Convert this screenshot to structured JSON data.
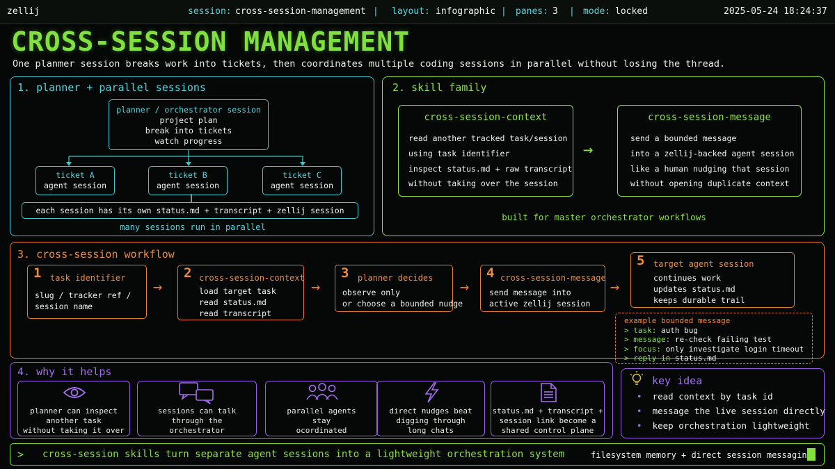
{
  "topbar": {
    "app": "zellij",
    "session_label": "session:",
    "session_value": "cross-session-management",
    "layout_label": "layout:",
    "layout_value": "infographic",
    "panes_label": "panes:",
    "panes_value": "3",
    "mode_label": "mode:",
    "mode_value": "locked",
    "separator": "|",
    "timestamp": "2025-05-24 18:24:37"
  },
  "header": {
    "title": "CROSS-SESSION MANAGEMENT",
    "subtitle": "One planmer session breaks work into tickets, then coordinates multiple coding sessions in parallel without losing the thread."
  },
  "panel1": {
    "title": "1. planner + parallel sessions",
    "planner": {
      "title": "planner / orchestrator session",
      "lines": [
        "project plan",
        "break into tickets",
        "watch progress"
      ]
    },
    "tickets": [
      {
        "title": "ticket A",
        "sub": "agent session"
      },
      {
        "title": "ticket B",
        "sub": "agent session"
      },
      {
        "title": "ticket C",
        "sub": "agent session"
      }
    ],
    "shared": "each session has its own status.md + transcript + zellij session",
    "footer": "many sessions run in parallel"
  },
  "panel2": {
    "title": "2. skill family",
    "context": {
      "title": "cross-session-context",
      "lines": [
        "read another tracked task/session",
        "using task identifier",
        "inspect status.md + raw transcript",
        "without taking over the session"
      ]
    },
    "arrow": "→",
    "message": {
      "title": "cross-session-message",
      "lines": [
        "send a bounded message",
        "into a zellij-backed agent session",
        "like a human nudging that session",
        "without opening duplicate context"
      ]
    },
    "footer": "built for master orchestrator workflows"
  },
  "panel3": {
    "title": "3. cross-session workflow",
    "arrow": "→",
    "steps": [
      {
        "num": "1",
        "title": "task identifier",
        "lines": [
          "slug / tracker ref /",
          "session name"
        ]
      },
      {
        "num": "2",
        "title": "cross-session-context",
        "lines": [
          "load target task",
          "read status.md",
          "read transcript"
        ]
      },
      {
        "num": "3",
        "title": "planner decides",
        "lines": [
          "observe only",
          "or choose a bounded nudge"
        ]
      },
      {
        "num": "4",
        "title": "cross-session-message",
        "lines": [
          "send message into",
          "active zellij session"
        ]
      },
      {
        "num": "5",
        "title": "target agent session",
        "lines": [
          "continues work",
          "updates status.md",
          "keeps durable trail"
        ]
      }
    ],
    "example": {
      "title": "example bounded message",
      "task_key": "> task:",
      "task_val": " auth bug",
      "msg_key": "> message:",
      "msg_val": " re-check failing test",
      "focus_key": "> focus:",
      "focus_val": " only investigate login timeout",
      "reply_key": "> reply in ",
      "reply_val": "status.md"
    }
  },
  "panel4": {
    "title": "4. why it helps",
    "items": [
      {
        "icon": "eye-icon",
        "lines": [
          "planner can inspect",
          "another task",
          "without taking it over"
        ]
      },
      {
        "icon": "chat-bubbles-icon",
        "lines": [
          "sessions can talk",
          "through the",
          "orchestrator"
        ]
      },
      {
        "icon": "people-group-icon",
        "lines": [
          "parallel agents",
          "stay",
          "ocordinated"
        ]
      },
      {
        "icon": "lightning-icon",
        "lines": [
          "direct nudges beat",
          "digging through",
          "long chats"
        ]
      },
      {
        "icon": "document-icon",
        "lines": [
          "status.md + transcript +",
          "session link become a",
          "shared control plane"
        ]
      }
    ]
  },
  "keyidea": {
    "title": "key idea",
    "icon": "lightbulb-icon",
    "bullet": "•",
    "items": [
      "read context by task id",
      "message the live session directly",
      "keep orchestration lightweight"
    ]
  },
  "bottombar": {
    "prompt": ">",
    "text": "cross-session skills turn separate agent sessions into a lightweight orchestration system",
    "right": "filesystem memory + direct session messaging"
  },
  "colors": {
    "cyan": "#4fd6df",
    "green": "#8ee04a",
    "orange": "#f08a3c",
    "purple": "#a46ff0",
    "background": "#050806"
  }
}
